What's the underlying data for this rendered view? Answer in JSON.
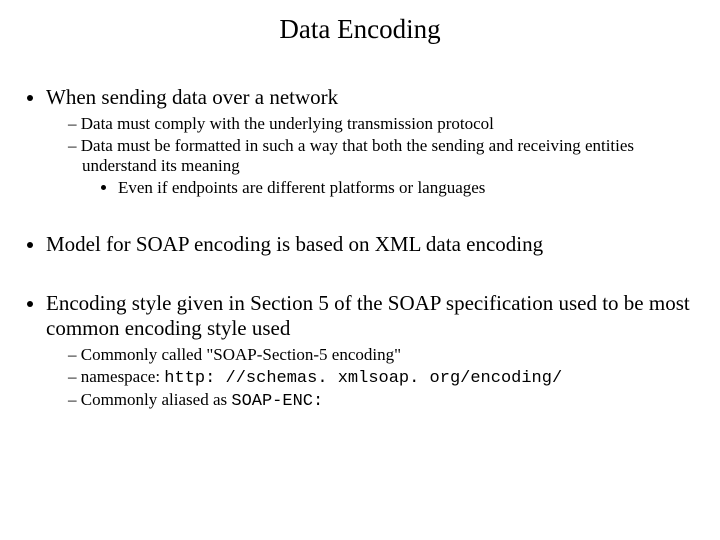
{
  "title": "Data Encoding",
  "bullets": {
    "b1": {
      "text": "When sending data over a network",
      "sub": {
        "s1": "Data must comply with the underlying transmission protocol",
        "s2": "Data must be formatted in such a way that both the sending and receiving entities understand its meaning",
        "s2_sub": {
          "t1": "Even if endpoints are different platforms or languages"
        }
      }
    },
    "b2": {
      "text": "Model for SOAP encoding is based on XML data encoding"
    },
    "b3": {
      "text": "Encoding style given in Section 5 of the SOAP specification used to be most common encoding style used",
      "sub": {
        "s1": "Commonly called \"SOAP-Section-5 encoding\"",
        "s2_label": "namespace: ",
        "s2_code": "http: //schemas. xmlsoap. org/encoding/",
        "s3_label": "Commonly aliased as ",
        "s3_code": "SOAP-ENC:"
      }
    }
  }
}
